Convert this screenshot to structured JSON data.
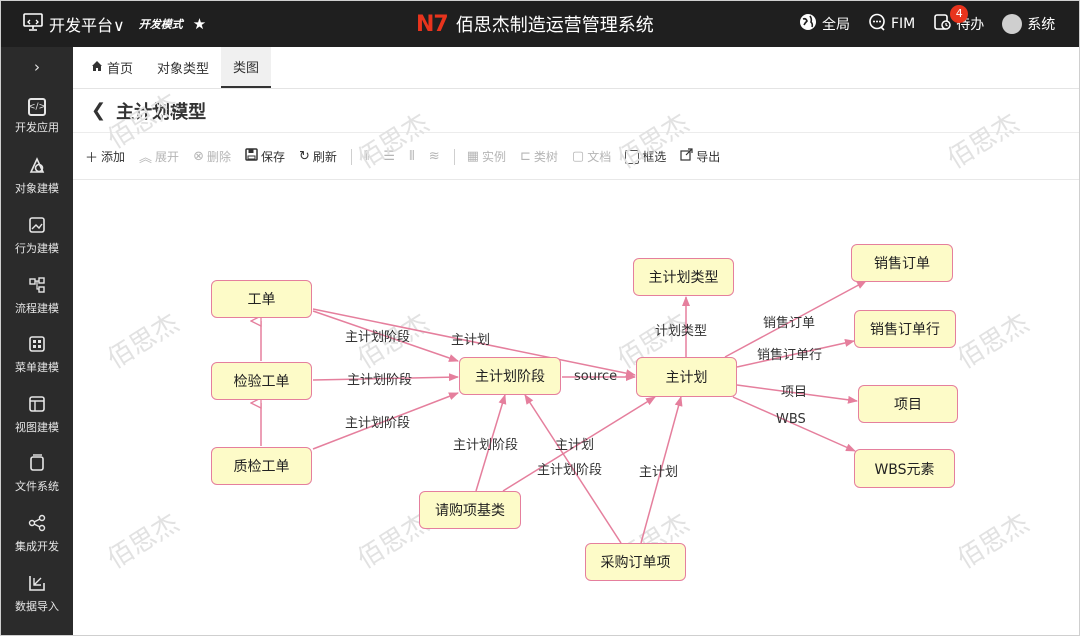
{
  "topbar": {
    "platform": "开发平台∨",
    "mode": "开发模式",
    "logo": "N7",
    "system_name": "佰思杰制造运营管理系统",
    "global_label": "全局",
    "fim_label": "FIM",
    "todo_label": "待办",
    "todo_count": "4",
    "user_label": "系统",
    "accent_color": "#e8341d"
  },
  "sidebar": {
    "toggle": "›",
    "items": [
      {
        "label": "开发应用",
        "icon": "monitor-code-icon"
      },
      {
        "label": "对象建模",
        "icon": "model-icon"
      },
      {
        "label": "行为建模",
        "icon": "picture-icon"
      },
      {
        "label": "流程建模",
        "icon": "flow-icon"
      },
      {
        "label": "菜单建模",
        "icon": "menu-grid-icon"
      },
      {
        "label": "视图建模",
        "icon": "view-icon"
      },
      {
        "label": "文件系统",
        "icon": "file-icon"
      },
      {
        "label": "集成开发",
        "icon": "share-icon"
      },
      {
        "label": "数据导入",
        "icon": "import-icon"
      }
    ]
  },
  "tabs": [
    {
      "label": "首页",
      "active": false
    },
    {
      "label": "对象类型",
      "active": false
    },
    {
      "label": "类图",
      "active": true
    }
  ],
  "title": "主计划模型",
  "toolbar": {
    "add": "添加",
    "expand": "展开",
    "delete": "删除",
    "save": "保存",
    "refresh": "刷新",
    "instance": "实例",
    "class_tree": "类树",
    "document": "文档",
    "box_select": "框选",
    "export": "导出"
  },
  "watermark": "佰思杰",
  "diagram": {
    "nodes": {
      "work_order": "工单",
      "inspect_order": "检验工单",
      "qc_order": "质检工单",
      "plan_stage": "主计划阶段",
      "plan": "主计划",
      "plan_type": "主计划类型",
      "sales_order": "销售订单",
      "sales_order_line": "销售订单行",
      "project": "项目",
      "wbs": "WBS元素",
      "purchase_req": "请购项基类",
      "purchase_line": "采购订单项"
    },
    "edges": {
      "wo_stage": "主计划阶段",
      "wo_plan": "主计划",
      "io_stage": "主计划阶段",
      "qc_stage": "主计划阶段",
      "stage_plan": "source",
      "plan_type": "计划类型",
      "plan_sales": "销售订单",
      "plan_sales_line": "销售订单行",
      "plan_project": "项目",
      "plan_wbs": "WBS",
      "req_stage": "主计划阶段",
      "req_plan": "主计划",
      "pl_stage": "主计划阶段",
      "pl_plan": "主计划"
    },
    "node_fill": "#fdfbc8",
    "edge_color": "#e57f9d"
  }
}
